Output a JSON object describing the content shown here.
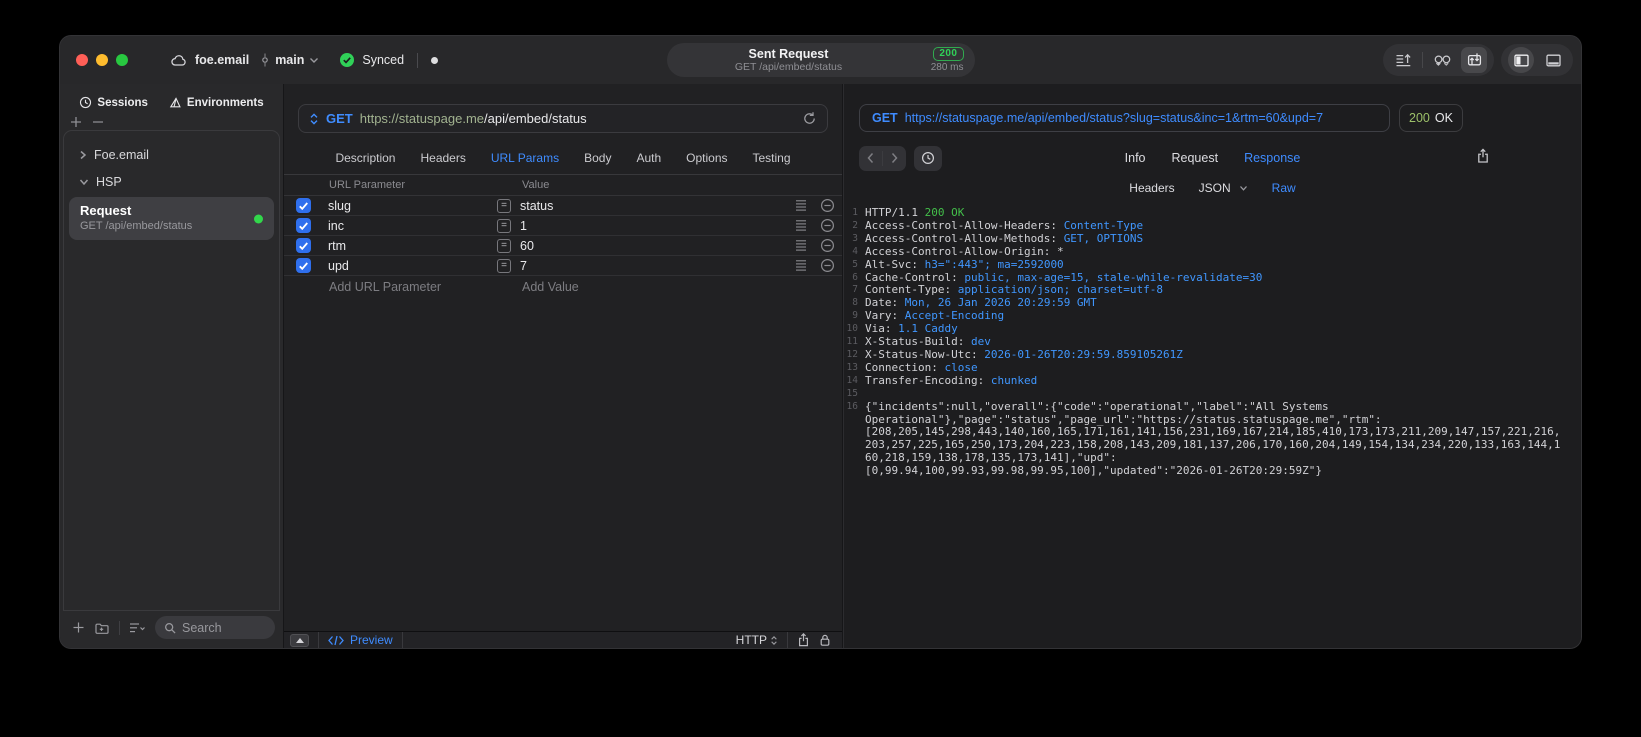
{
  "titlebar": {
    "project": "foe.email",
    "branch": "main",
    "sync_label": "Synced",
    "center": {
      "title": "Sent Request",
      "subtitle": "GET /api/embed/status",
      "status_code": "200",
      "duration": "280 ms"
    }
  },
  "sidebar": {
    "tabs": [
      {
        "label": "Sessions"
      },
      {
        "label": "Environments"
      }
    ],
    "tree": {
      "collapsed_group": "Foe.email",
      "expanded_group": "HSP",
      "request_title": "Request",
      "request_subtitle": "GET /api/embed/status"
    },
    "search_placeholder": "Search"
  },
  "request_editor": {
    "method": "GET",
    "url_host": "https://statuspage.me",
    "url_path": "/api/embed/status",
    "tabs": [
      "Description",
      "Headers",
      "URL Params",
      "Body",
      "Auth",
      "Options",
      "Testing"
    ],
    "active_tab": "URL Params",
    "params": {
      "col_name": "URL Parameter",
      "col_value": "Value",
      "rows": [
        {
          "name": "slug",
          "value": "status",
          "enabled": true
        },
        {
          "name": "inc",
          "value": "1",
          "enabled": true
        },
        {
          "name": "rtm",
          "value": "60",
          "enabled": true
        },
        {
          "name": "upd",
          "value": "7",
          "enabled": true
        }
      ],
      "add_name_label": "Add URL Parameter",
      "add_value_label": "Add Value"
    },
    "footer": {
      "preview_label": "Preview",
      "protocol": "HTTP"
    }
  },
  "response_viewer": {
    "method": "GET",
    "url": "https://statuspage.me/api/embed/status?slug=status&inc=1&rtm=60&upd=7",
    "status_code": "200",
    "status_text": "OK",
    "tabs": [
      "Info",
      "Request",
      "Response"
    ],
    "active_tab": "Response",
    "subtabs": [
      {
        "label": "Headers"
      },
      {
        "label": "JSON",
        "chevron": true
      },
      {
        "label": "Raw"
      }
    ],
    "active_subtab": "Raw",
    "lines": [
      {
        "n": "1",
        "parts": [
          [
            "HTTP/1.1 ",
            "k"
          ],
          [
            "200 OK",
            "g"
          ]
        ]
      },
      {
        "n": "2",
        "parts": [
          [
            "Access-Control-Allow-Headers: ",
            "k"
          ],
          [
            "Content-Type",
            "v"
          ]
        ]
      },
      {
        "n": "3",
        "parts": [
          [
            "Access-Control-Allow-Methods: ",
            "k"
          ],
          [
            "GET, OPTIONS",
            "v"
          ]
        ]
      },
      {
        "n": "4",
        "parts": [
          [
            "Access-Control-Allow-Origin: *",
            "k"
          ]
        ]
      },
      {
        "n": "5",
        "parts": [
          [
            "Alt-Svc: ",
            "k"
          ],
          [
            "h3=\":443\"; ma=2592000",
            "v"
          ]
        ]
      },
      {
        "n": "6",
        "parts": [
          [
            "Cache-Control: ",
            "k"
          ],
          [
            "public, max-age=15, stale-while-revalidate=30",
            "v"
          ]
        ]
      },
      {
        "n": "7",
        "parts": [
          [
            "Content-Type: ",
            "k"
          ],
          [
            "application/json; charset=utf-8",
            "v"
          ]
        ]
      },
      {
        "n": "8",
        "parts": [
          [
            "Date: ",
            "k"
          ],
          [
            "Mon, 26 Jan 2026 20:29:59 GMT",
            "v"
          ]
        ]
      },
      {
        "n": "9",
        "parts": [
          [
            "Vary: ",
            "k"
          ],
          [
            "Accept-Encoding",
            "v"
          ]
        ]
      },
      {
        "n": "10",
        "parts": [
          [
            "Via: ",
            "k"
          ],
          [
            "1.1 Caddy",
            "v"
          ]
        ]
      },
      {
        "n": "11",
        "parts": [
          [
            "X-Status-Build: ",
            "k"
          ],
          [
            "dev",
            "v"
          ]
        ]
      },
      {
        "n": "12",
        "parts": [
          [
            "X-Status-Now-Utc: ",
            "k"
          ],
          [
            "2026-01-26T20:29:59.859105261Z",
            "v"
          ]
        ]
      },
      {
        "n": "13",
        "parts": [
          [
            "Connection: ",
            "k"
          ],
          [
            "close",
            "v"
          ]
        ]
      },
      {
        "n": "14",
        "parts": [
          [
            "Transfer-Encoding: ",
            "k"
          ],
          [
            "chunked",
            "v"
          ]
        ]
      },
      {
        "n": "15",
        "parts": [
          [
            "",
            "k"
          ]
        ]
      },
      {
        "n": "16",
        "parts": [
          [
            "{\"incidents\":null,\"overall\":{\"code\":\"operational\",\"label\":\"All Systems\nOperational\"},\"page\":\"status\",\"page_url\":\"https://status.statuspage.me\",\"rtm\":\n[208,205,145,298,443,140,160,165,171,161,141,156,231,169,167,214,185,410,173,173,211,209,147,157,221,216,\n203,257,225,165,250,173,204,223,158,208,143,209,181,137,206,170,160,204,149,154,134,234,220,133,163,144,1\n60,218,159,138,178,135,173,141],\"upd\":\n[0,99.94,100,99.93,99.98,99.95,100],\"updated\":\"2026-01-26T20:29:59Z\"}",
            "k"
          ]
        ]
      }
    ]
  },
  "colors": {
    "accent": "#3f8cff",
    "green": "#30d158",
    "checkbox_blue": "#2f6fed",
    "status_green": "#9cc069",
    "host_green": "#a2b390"
  }
}
